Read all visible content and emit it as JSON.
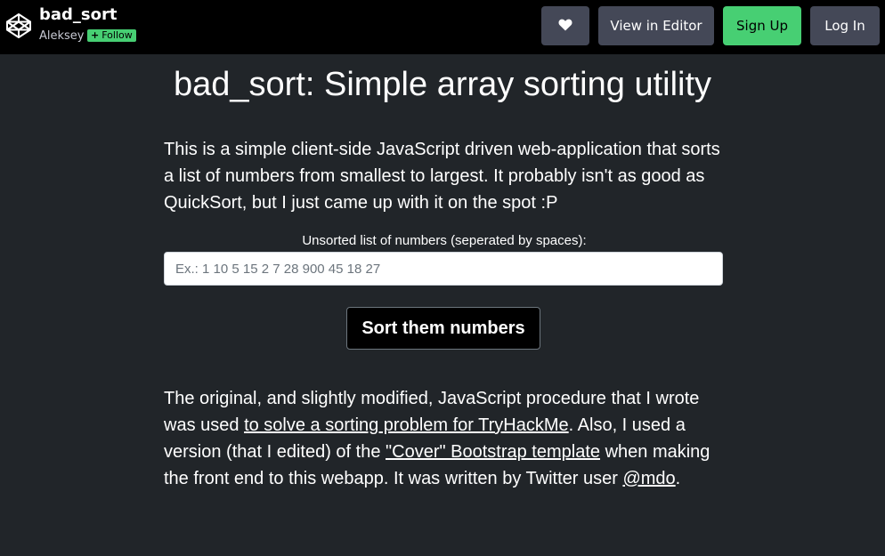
{
  "header": {
    "pen_title": "bad_sort",
    "author": "Aleksey",
    "follow_label": "Follow",
    "heart_icon": "heart-icon",
    "view_editor_label": "View in Editor",
    "signup_label": "Sign Up",
    "login_label": "Log In",
    "colors": {
      "bar": "#000000",
      "signup": "#47cf73",
      "button": "#444857"
    }
  },
  "main": {
    "title": "bad_sort: Simple array sorting utility",
    "intro": "This is a simple client-side JavaScript driven web-application that sorts a list of numbers from smallest to largest. It probably isn't as good as QuickSort, but I just came up with it on the spot :P",
    "input_label": "Unsorted list of numbers (seperated by spaces):",
    "input_placeholder": "Ex.: 1 10 5 15 2 7 28 900 45 18 27",
    "input_value": "",
    "sort_button": "Sort them numbers",
    "outro": {
      "part1": "The original, and slightly modified, JavaScript procedure that I wrote was used ",
      "link1": "to solve a sorting problem for TryHackMe",
      "part2": ". Also, I used a version (that I edited) of the ",
      "link2": "\"Cover\" Bootstrap template",
      "part3": " when making the front end to this webapp. It was written by Twitter user ",
      "link3": "@mdo",
      "part4": "."
    },
    "background_color": "#212529"
  }
}
